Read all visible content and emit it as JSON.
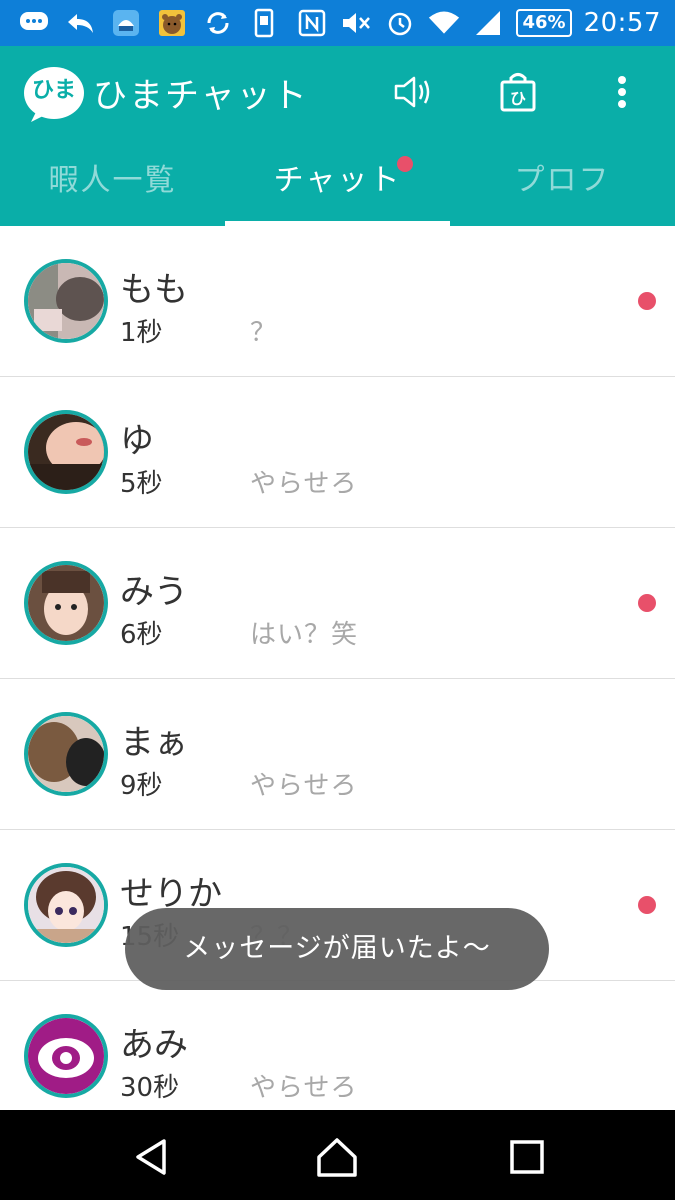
{
  "status_bar": {
    "icons_left": [
      "message-icon",
      "reply-icon",
      "app-icon",
      "bear-app-icon",
      "sync-icon",
      "phone-icon"
    ],
    "icons_right": [
      "nfc-icon",
      "mute-icon",
      "alarm-icon",
      "wifi-icon",
      "signal-icon"
    ],
    "battery": "46%",
    "time": "20:57",
    "color": "#0e7fd8"
  },
  "app_bar": {
    "logo_text": "ひま",
    "title": "ひまチャット",
    "color": "#0aaea8",
    "actions": [
      "speaker-icon",
      "shop-bag-icon",
      "more-vert-icon"
    ],
    "shop_glyph": "ひ"
  },
  "tabs": [
    {
      "label": "暇人一覧",
      "active": false
    },
    {
      "label": "チャット",
      "active": true,
      "badge": true
    },
    {
      "label": "プロフ",
      "active": false
    }
  ],
  "chats": [
    {
      "name": "もも",
      "time": "1秒",
      "message": "？",
      "unread": true
    },
    {
      "name": "ゆ",
      "time": "5秒",
      "message": "やらせろ",
      "unread": false
    },
    {
      "name": "みう",
      "time": "6秒",
      "message": "はい？笑",
      "unread": true
    },
    {
      "name": "まぁ",
      "time": "9秒",
      "message": "やらせろ",
      "unread": false
    },
    {
      "name": "せりか",
      "time": "15秒",
      "message": "？？",
      "unread": true
    },
    {
      "name": "あみ",
      "time": "30秒",
      "message": "やらせろ",
      "unread": false
    }
  ],
  "toast": {
    "text": "メッセージが届いたよ〜"
  },
  "colors": {
    "accent": "#0aaea8",
    "unread_dot": "#e8506a",
    "avatar_ring": "#17a9a4"
  },
  "nav_bar": [
    "back-icon",
    "home-icon",
    "recents-icon"
  ]
}
